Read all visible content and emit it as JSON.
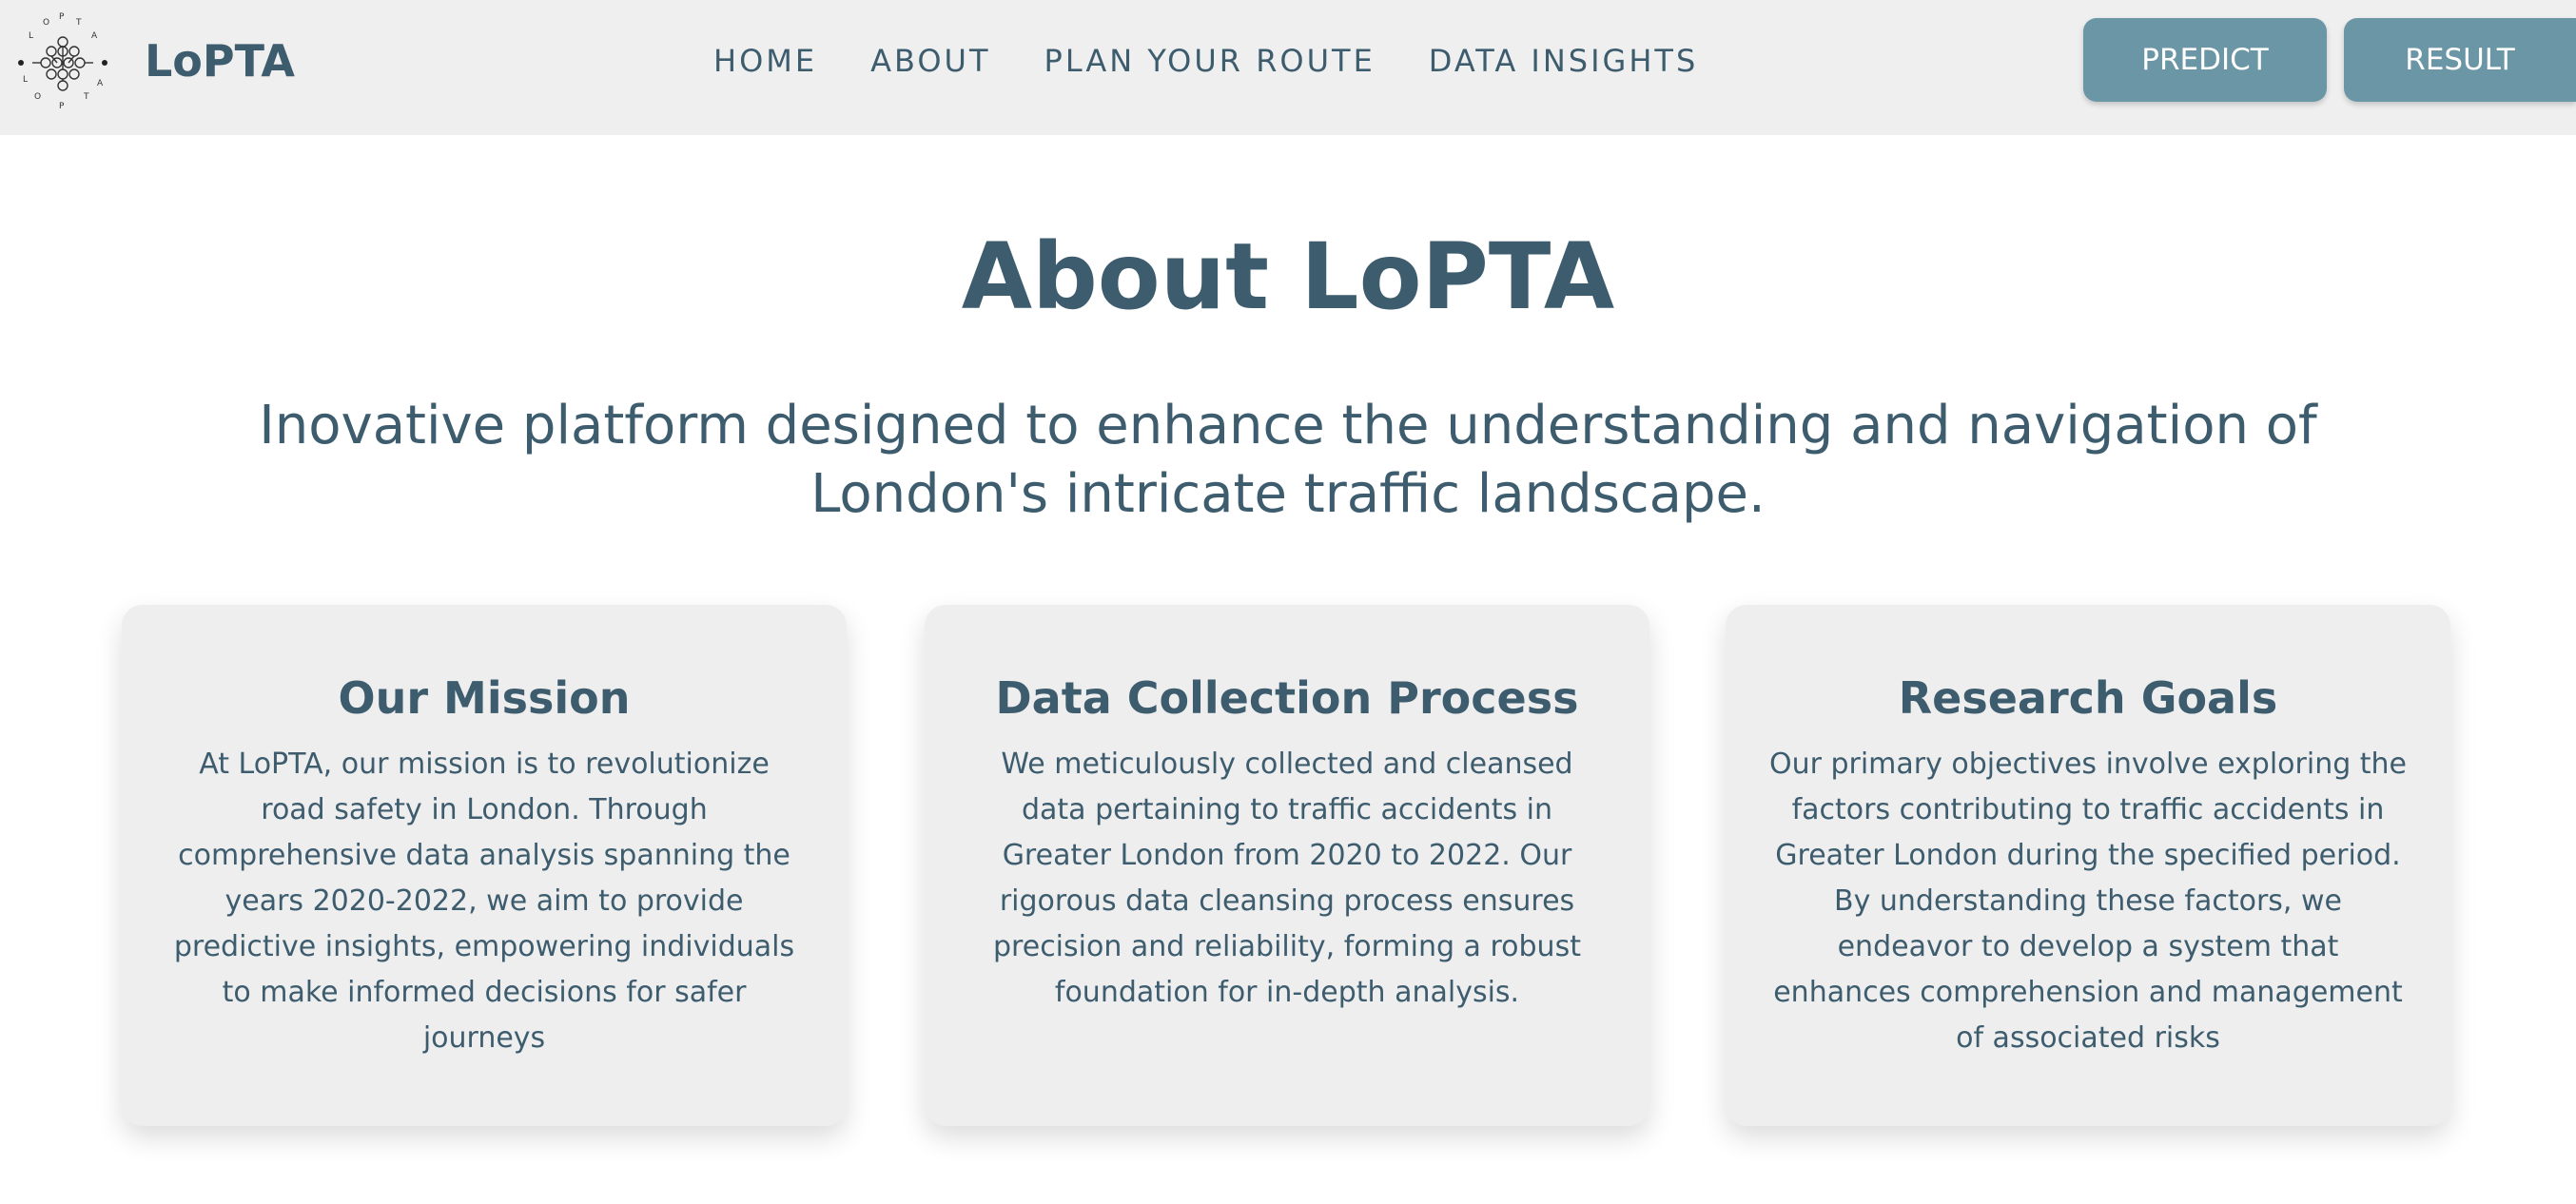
{
  "nav": {
    "brand": "LoPTA",
    "logo_icon": "lopta-logo-icon",
    "links": [
      "HOME",
      "ABOUT",
      "PLAN YOUR ROUTE",
      "DATA INSIGHTS"
    ],
    "predict_label": "PREDICT",
    "result_label": "RESULT"
  },
  "main": {
    "title": "About LoPTA",
    "subtitle": "Inovative platform designed to enhance the understanding and navigation of London's intricate traffic landscape."
  },
  "cards": [
    {
      "title": "Our Mission",
      "body": "At LoPTA, our mission is to revolutionize road safety in London. Through comprehensive data analysis spanning the years 2020-2022, we aim to provide predictive insights, empowering individuals to make informed decisions for safer journeys"
    },
    {
      "title": "Data Collection Process",
      "body": "We meticulously collected and cleansed data pertaining to traffic accidents in Greater London from 2020 to 2022. Our rigorous data cleansing process ensures precision and reliability, forming a robust foundation for in-depth analysis."
    },
    {
      "title": "Research Goals",
      "body": "Our primary objectives involve exploring the factors contributing to traffic accidents in Greater London during the specified period. By understanding these factors, we endeavor to develop a system that enhances comprehension and management of associated risks"
    }
  ],
  "colors": {
    "primary_text": "#3d5c6e",
    "button_bg": "#6a96a5",
    "navbar_bg": "#efefef",
    "card_bg": "#eeeeee"
  }
}
